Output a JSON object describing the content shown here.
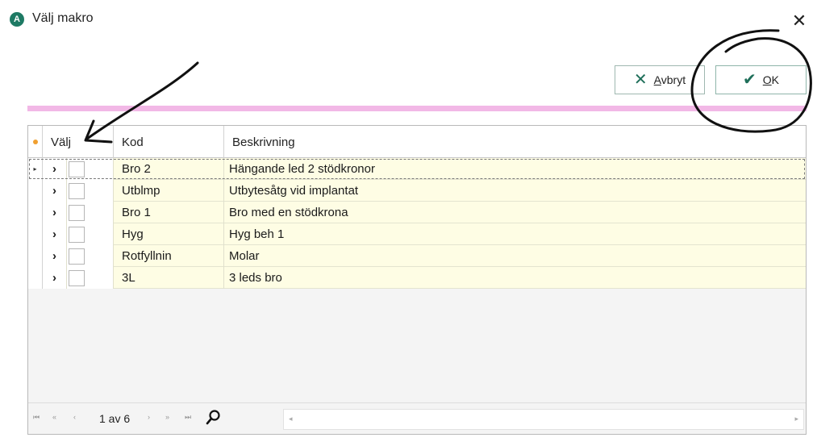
{
  "window": {
    "app_icon_letter": "A",
    "title": "Välj makro",
    "close_glyph": "✕"
  },
  "toolbar": {
    "cancel": {
      "icon": "✕",
      "label_accel": "A",
      "label_rest": "vbryt"
    },
    "ok": {
      "icon": "✔",
      "label_accel": "O",
      "label_rest": "K"
    }
  },
  "grid": {
    "columns": [
      "Välj",
      "Kod",
      "Beskrivning"
    ],
    "rows": [
      {
        "kod": "Bro 2",
        "beskrivning": "Hängande led 2 stödkronor",
        "selected": true
      },
      {
        "kod": "Utblmp",
        "beskrivning": "Utbytesåtg vid implantat",
        "selected": false
      },
      {
        "kod": "Bro 1",
        "beskrivning": "Bro med en stödkrona",
        "selected": false
      },
      {
        "kod": "Hyg",
        "beskrivning": "Hyg beh 1",
        "selected": false
      },
      {
        "kod": "Rotfyllnin",
        "beskrivning": "Molar",
        "selected": false
      },
      {
        "kod": "3L",
        "beskrivning": "3 leds bro",
        "selected": false
      }
    ],
    "expand_glyph": "›",
    "current_row_glyph": "▸"
  },
  "navigator": {
    "position_text": "1 av 6",
    "first": "⏮",
    "prev_page": "«",
    "prev": "‹",
    "next": "›",
    "next_page": "»",
    "last": "⏭"
  },
  "colors": {
    "accent": "#1f6f5a",
    "row_background": "#fefde4",
    "separator": "#f2b8e6"
  }
}
